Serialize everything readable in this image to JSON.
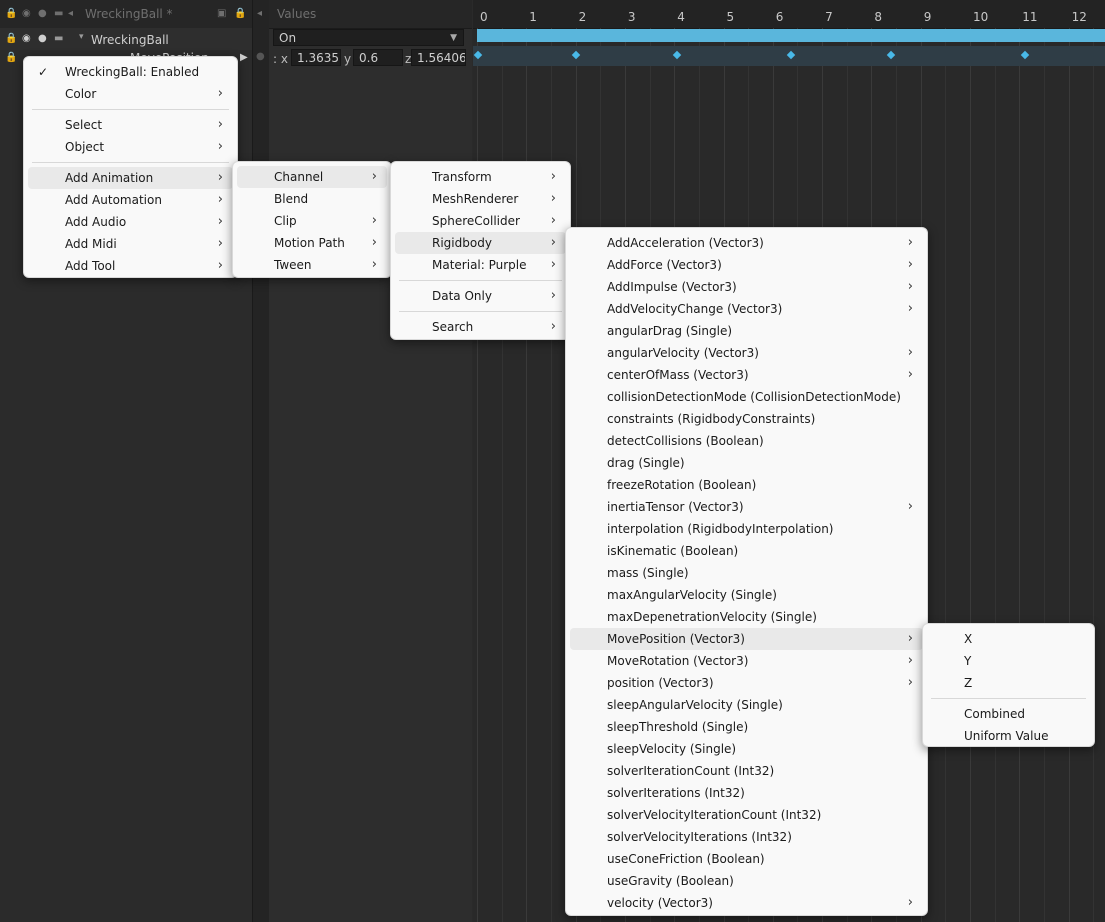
{
  "hierarchy": {
    "header_title": "WreckingBall *",
    "track_name": "WreckingBall",
    "subtrack_name": "MovePosition"
  },
  "values_panel": {
    "header": "Values",
    "on_value": "On",
    "x_label": ": x",
    "x_value": "1.36357",
    "y_label": "y",
    "y_value": "0.6",
    "z_label": "z",
    "z_value": "1.56406"
  },
  "timeline": {
    "ticks": [
      "0",
      "1",
      "2",
      "3",
      "4",
      "5",
      "6",
      "7",
      "8",
      "9",
      "10",
      "11",
      "12"
    ],
    "on_bar_color": "#5ab6dc",
    "key_color": "#49b9e8"
  },
  "menu1": {
    "items": [
      {
        "label": "WreckingBall: Enabled",
        "check": "✓"
      },
      {
        "label": "Color",
        "chevron": "›"
      },
      {
        "label": "Select",
        "chevron": "›"
      },
      {
        "label": "Object",
        "chevron": "›"
      },
      {
        "label": "Add Animation",
        "chevron": "›"
      },
      {
        "label": "Add Automation",
        "chevron": "›"
      },
      {
        "label": "Add Audio",
        "chevron": "›"
      },
      {
        "label": "Add Midi",
        "chevron": "›"
      },
      {
        "label": "Add Tool",
        "chevron": "›"
      }
    ]
  },
  "menu2": {
    "items": [
      {
        "label": "Channel",
        "chevron": "›"
      },
      {
        "label": "Blend"
      },
      {
        "label": "Clip",
        "chevron": "›"
      },
      {
        "label": "Motion Path",
        "chevron": "›"
      },
      {
        "label": "Tween",
        "chevron": "›"
      }
    ]
  },
  "menu3": {
    "items": [
      {
        "label": "Transform",
        "chevron": "›"
      },
      {
        "label": "MeshRenderer",
        "chevron": "›"
      },
      {
        "label": "SphereCollider",
        "chevron": "›"
      },
      {
        "label": "Rigidbody",
        "chevron": "›"
      },
      {
        "label": "Material: Purple",
        "chevron": "›"
      },
      {
        "label": "Data Only",
        "chevron": "›"
      },
      {
        "label": "Search",
        "chevron": "›"
      }
    ]
  },
  "menu4": {
    "items": [
      {
        "label": "AddAcceleration (Vector3)",
        "chevron": "›"
      },
      {
        "label": "AddForce (Vector3)",
        "chevron": "›"
      },
      {
        "label": "AddImpulse (Vector3)",
        "chevron": "›"
      },
      {
        "label": "AddVelocityChange (Vector3)",
        "chevron": "›"
      },
      {
        "label": "angularDrag (Single)"
      },
      {
        "label": "angularVelocity (Vector3)",
        "chevron": "›"
      },
      {
        "label": "centerOfMass (Vector3)",
        "chevron": "›"
      },
      {
        "label": "collisionDetectionMode (CollisionDetectionMode)"
      },
      {
        "label": "constraints (RigidbodyConstraints)"
      },
      {
        "label": "detectCollisions (Boolean)"
      },
      {
        "label": "drag (Single)"
      },
      {
        "label": "freezeRotation (Boolean)"
      },
      {
        "label": "inertiaTensor (Vector3)",
        "chevron": "›"
      },
      {
        "label": "interpolation (RigidbodyInterpolation)"
      },
      {
        "label": "isKinematic (Boolean)"
      },
      {
        "label": "mass (Single)"
      },
      {
        "label": "maxAngularVelocity (Single)"
      },
      {
        "label": "maxDepenetrationVelocity (Single)"
      },
      {
        "label": "MovePosition (Vector3)",
        "chevron": "›"
      },
      {
        "label": "MoveRotation (Vector3)",
        "chevron": "›"
      },
      {
        "label": "position (Vector3)",
        "chevron": "›"
      },
      {
        "label": "sleepAngularVelocity (Single)"
      },
      {
        "label": "sleepThreshold (Single)"
      },
      {
        "label": "sleepVelocity (Single)"
      },
      {
        "label": "solverIterationCount (Int32)"
      },
      {
        "label": "solverIterations (Int32)"
      },
      {
        "label": "solverVelocityIterationCount (Int32)"
      },
      {
        "label": "solverVelocityIterations (Int32)"
      },
      {
        "label": "useConeFriction (Boolean)"
      },
      {
        "label": "useGravity (Boolean)"
      },
      {
        "label": "velocity (Vector3)",
        "chevron": "›"
      }
    ]
  },
  "menu5": {
    "items": [
      {
        "label": "X"
      },
      {
        "label": "Y"
      },
      {
        "label": "Z"
      },
      {
        "label": "Combined"
      },
      {
        "label": "Uniform Value"
      }
    ]
  }
}
